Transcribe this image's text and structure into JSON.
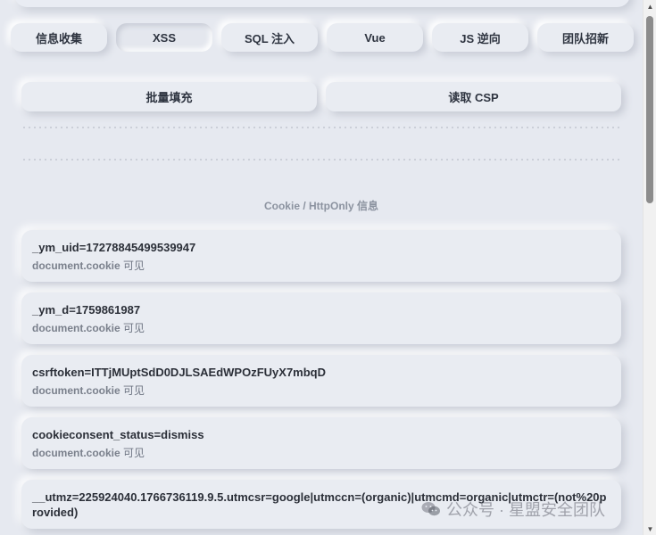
{
  "tabs": [
    {
      "label": "信息收集",
      "active": false
    },
    {
      "label": "XSS",
      "active": true
    },
    {
      "label": "SQL 注入",
      "active": false
    },
    {
      "label": "Vue",
      "active": false
    },
    {
      "label": "JS 逆向",
      "active": false
    },
    {
      "label": "团队招新",
      "active": false
    }
  ],
  "actions": {
    "batch_fill": "批量填充",
    "read_csp": "读取 CSP"
  },
  "section": {
    "title": "Cookie / HttpOnly 信息"
  },
  "cookies": [
    {
      "value": "_ym_uid=17278845499539947",
      "source": "document.cookie",
      "note": "可见"
    },
    {
      "value": "_ym_d=1759861987",
      "source": "document.cookie",
      "note": "可见"
    },
    {
      "value": "csrftoken=ITTjMUptSdD0DJLSAEdWPOzFUyX7mbqD",
      "source": "document.cookie",
      "note": "可见"
    },
    {
      "value": "cookieconsent_status=dismiss",
      "source": "document.cookie",
      "note": "可见"
    },
    {
      "value": "__utmz=225924040.1766736119.9.5.utmcsr=google|utmccn=(organic)|utmcmd=organic|utmctr=(not%20provided)",
      "source": "",
      "note": ""
    }
  ],
  "watermark": {
    "text": "公众号 · 星盟安全团队",
    "icon": "wechat-icon"
  }
}
